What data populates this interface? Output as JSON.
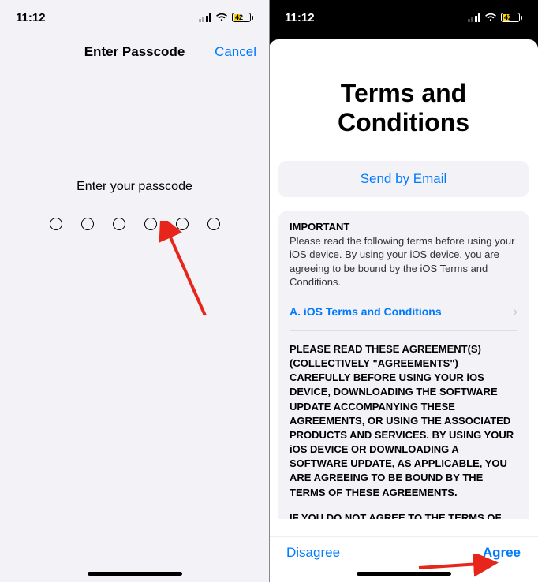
{
  "status": {
    "time": "11:12",
    "battery_pct": "42"
  },
  "left": {
    "title": "Enter Passcode",
    "cancel": "Cancel",
    "prompt": "Enter your passcode"
  },
  "right": {
    "heading": "Terms and Conditions",
    "send_email": "Send by Email",
    "important_label": "IMPORTANT",
    "important_text": "Please read the following terms before using your iOS device. By using your iOS device, you are agreeing to be bound by the iOS Terms and Conditions.",
    "section_link": "A. iOS Terms and Conditions",
    "terms_para1": "PLEASE READ THESE AGREEMENT(S) (COLLECTIVELY \"AGREEMENTS\") CAREFULLY BEFORE USING YOUR iOS DEVICE, DOWNLOADING THE SOFTWARE UPDATE ACCOMPANYING THESE AGREEMENTS, OR USING THE ASSOCIATED PRODUCTS AND SERVICES. BY USING YOUR iOS DEVICE OR DOWNLOADING A SOFTWARE UPDATE, AS APPLICABLE, YOU ARE AGREEING TO BE BOUND BY THE TERMS OF THESE AGREEMENTS.",
    "terms_para2": "IF YOU DO NOT AGREE TO THE TERMS OF THESE AGREEMENTS, DO NOT USE THE iOS DEVICE OR DOWNLOAD THE SOFTWARE UPDATE. IF YOU HAVE RECENTLY PURCHASED",
    "disagree": "Disagree",
    "agree": "Agree"
  }
}
